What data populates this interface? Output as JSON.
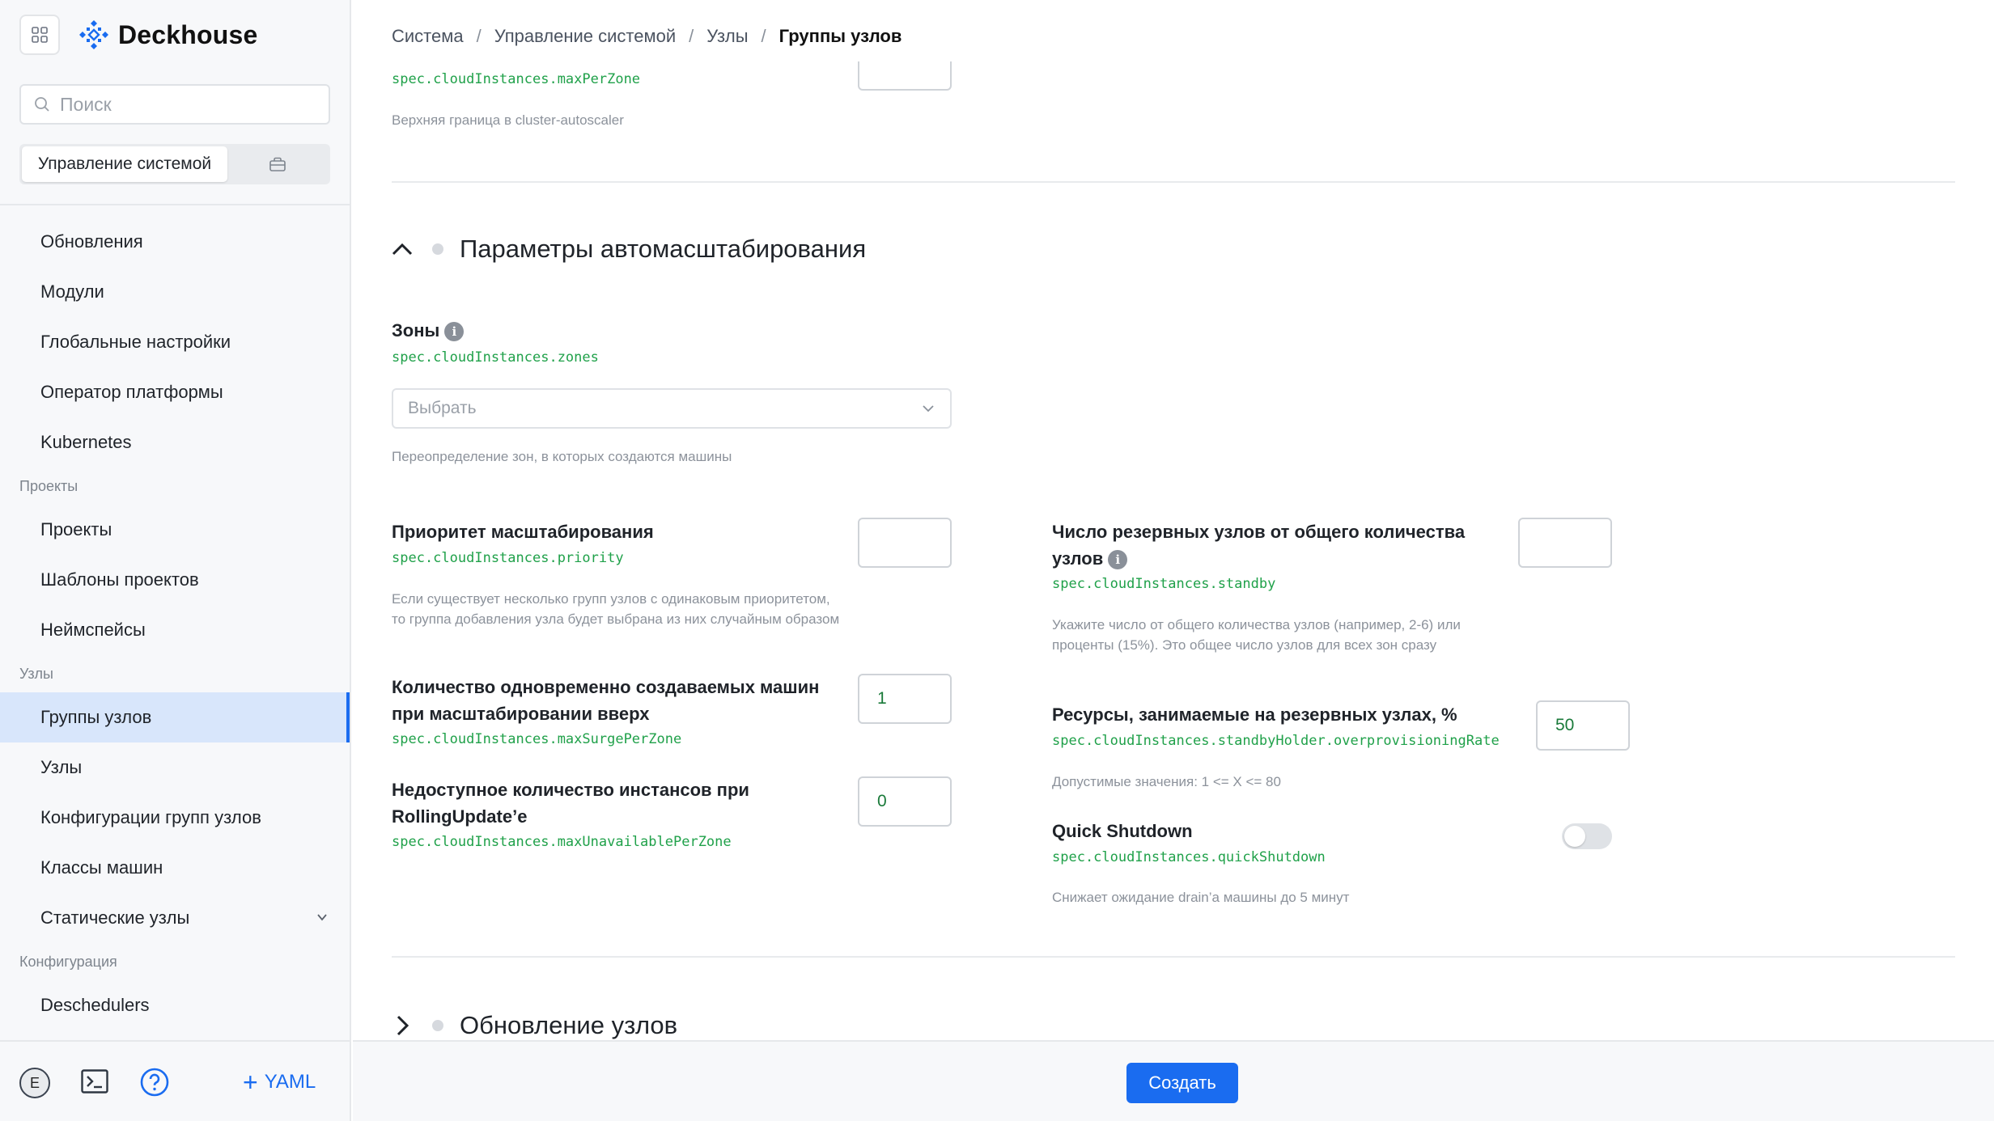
{
  "app": {
    "brand": "Deckhouse"
  },
  "sidebar": {
    "search_placeholder": "Поиск",
    "segment_active": "Управление системой",
    "nav": [
      {
        "type": "item",
        "label": "Обновления"
      },
      {
        "type": "item",
        "label": "Модули"
      },
      {
        "type": "item",
        "label": "Глобальные настройки"
      },
      {
        "type": "item",
        "label": "Оператор платформы"
      },
      {
        "type": "item",
        "label": "Kubernetes"
      },
      {
        "type": "section",
        "label": "Проекты"
      },
      {
        "type": "item",
        "label": "Проекты"
      },
      {
        "type": "item",
        "label": "Шаблоны проектов"
      },
      {
        "type": "item",
        "label": "Неймспейсы"
      },
      {
        "type": "section",
        "label": "Узлы"
      },
      {
        "type": "item",
        "label": "Группы узлов",
        "active": true
      },
      {
        "type": "item",
        "label": "Узлы"
      },
      {
        "type": "item",
        "label": "Конфигурации групп узлов"
      },
      {
        "type": "item",
        "label": "Классы машин"
      },
      {
        "type": "item",
        "label": "Статические узлы",
        "expandable": true
      },
      {
        "type": "section",
        "label": "Конфигурация"
      },
      {
        "type": "item",
        "label": "Deschedulers"
      }
    ],
    "avatar_letter": "E",
    "yaml_label": "YAML"
  },
  "breadcrumb": {
    "items": [
      "Система",
      "Управление системой",
      "Узлы"
    ],
    "separator": "/",
    "current": "Группы узлов"
  },
  "form": {
    "max_per_zone": {
      "code": "spec.cloudInstances.maxPerZone",
      "hint": "Верхняя граница в cluster-autoscaler",
      "value": ""
    },
    "autoscale_section": {
      "title": "Параметры автомасштабирования"
    },
    "zones": {
      "label": "Зоны",
      "code": "spec.cloudInstances.zones",
      "placeholder": "Выбрать",
      "hint": "Переопределение зон, в которых создаются машины"
    },
    "priority": {
      "label": "Приоритет масштабирования",
      "code": "spec.cloudInstances.priority",
      "hint": "Если существует несколько групп узлов с одинаковым приоритетом, то группа добавления узла будет выбрана из них случайным образом",
      "value": ""
    },
    "max_surge": {
      "label": "Количество одновременно создаваемых машин при масштабировании вверх",
      "code": "spec.cloudInstances.maxSurgePerZone",
      "value": "1"
    },
    "max_unavailable": {
      "label": "Недоступное количество инстансов при RollingUpdate’е",
      "code": "spec.cloudInstances.maxUnavailablePerZone",
      "value": "0"
    },
    "standby": {
      "label": "Число резервных узлов от общего количества узлов",
      "code": "spec.cloudInstances.standby",
      "hint": "Укажите число от общего количества узлов (например, 2-6) или проценты (15%). Это общее число узлов для всех зон сразу",
      "value": ""
    },
    "overprovisioning": {
      "label": "Ресурсы, занимаемые на резервных узлах, %",
      "code": "spec.cloudInstances.standbyHolder.overprovisioningRate",
      "hint": "Допустимые значения: 1 <= X <= 80",
      "value": "50"
    },
    "quick_shutdown": {
      "label": "Quick Shutdown",
      "code": "spec.cloudInstances.quickShutdown",
      "hint": "Снижает ожидание drain’a машины до 5 минут",
      "enabled": false
    },
    "node_update_section": {
      "title": "Обновление узлов"
    }
  },
  "footer": {
    "create_label": "Создать"
  },
  "colors": {
    "accent": "#1a6cf0",
    "code_green": "#20a14a",
    "active_nav_bg": "#d8e6fb"
  }
}
